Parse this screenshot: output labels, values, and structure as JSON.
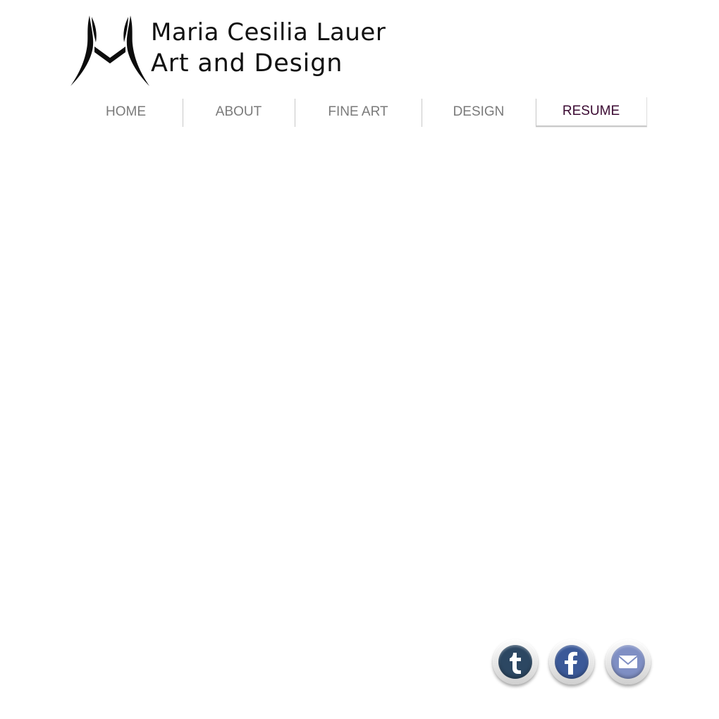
{
  "header": {
    "site_name": "Maria Cesilia Lauer",
    "tagline": "Art and Design",
    "logo_icon": "mcl-monogram-logo"
  },
  "nav": {
    "items": [
      {
        "label": "HOME",
        "active": false
      },
      {
        "label": "ABOUT",
        "active": false
      },
      {
        "label": "FINE ART",
        "active": false
      },
      {
        "label": "DESIGN",
        "active": false
      },
      {
        "label": "RESUME",
        "active": true
      }
    ],
    "active_color": "#3b0a32",
    "inactive_color": "#7a7a7a"
  },
  "social": {
    "links": [
      {
        "icon": "tumblr-icon",
        "color": "#2c4762"
      },
      {
        "icon": "facebook-icon",
        "color": "#3b5998"
      },
      {
        "icon": "mail-icon",
        "color": "#7f8fc4"
      }
    ]
  }
}
